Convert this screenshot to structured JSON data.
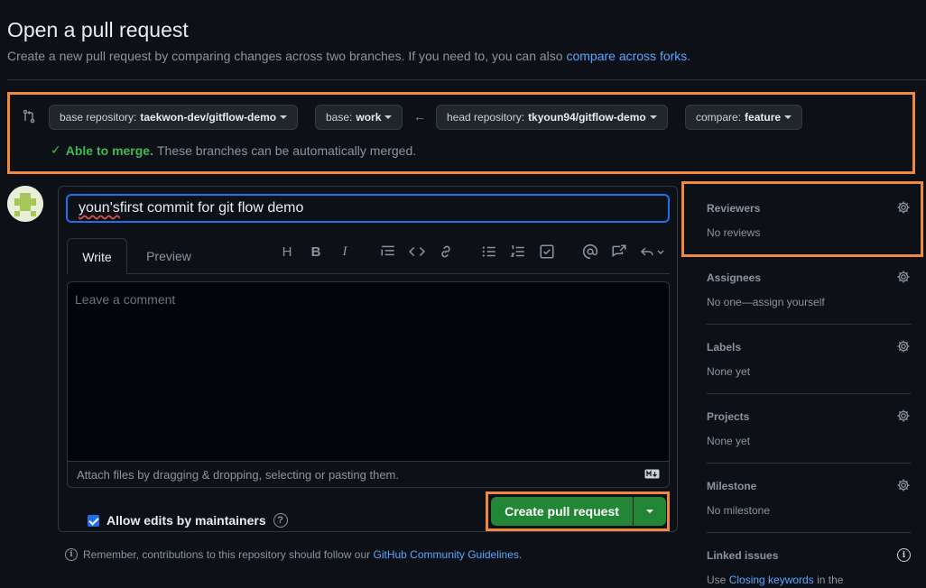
{
  "header": {
    "title": "Open a pull request",
    "subtitle": "Create a new pull request by comparing changes across two branches. If you need to, you can also",
    "subtitle_link": "compare across forks",
    "subtitle_end": "."
  },
  "compare": {
    "base_repo_label": "base repository:",
    "base_repo_value": "taekwon-dev/gitflow-demo",
    "base_label": "base:",
    "base_value": "work",
    "head_repo_label": "head repository:",
    "head_repo_value": "tkyoun94/gitflow-demo",
    "compare_label": "compare:",
    "compare_value": "feature",
    "merge_status": "Able to merge.",
    "merge_message": "These branches can be automatically merged."
  },
  "editor": {
    "title_value_misspelled": "youn's",
    "title_value_rest": " first commit for git flow demo",
    "tab_write": "Write",
    "tab_preview": "Preview",
    "comment_placeholder": "Leave a comment",
    "attach_hint": "Attach files by dragging & dropping, selecting or pasting them.",
    "toolbar_heading": "H",
    "toolbar_bold": "B",
    "toolbar_italic": "I"
  },
  "footer": {
    "allow_edits": "Allow edits by maintainers",
    "create_button": "Create pull request",
    "remember_text": "Remember, contributions to this repository should follow our",
    "remember_link": "GitHub Community Guidelines",
    "remember_end": "."
  },
  "sidebar": {
    "reviewers": {
      "heading": "Reviewers",
      "value": "No reviews"
    },
    "assignees": {
      "heading": "Assignees",
      "value": "No one—assign yourself"
    },
    "labels": {
      "heading": "Labels",
      "value": "None yet"
    },
    "projects": {
      "heading": "Projects",
      "value": "None yet"
    },
    "milestone": {
      "heading": "Milestone",
      "value": "No milestone"
    },
    "linked_issues": {
      "heading": "Linked issues",
      "value_start": "Use",
      "value_link": "Closing keywords",
      "value_end": "in the"
    }
  },
  "colors": {
    "background": "#0d1117",
    "accent_link": "#58a6ff",
    "success": "#3fb950",
    "primary_button": "#238636",
    "highlight_border": "#f0883e"
  }
}
